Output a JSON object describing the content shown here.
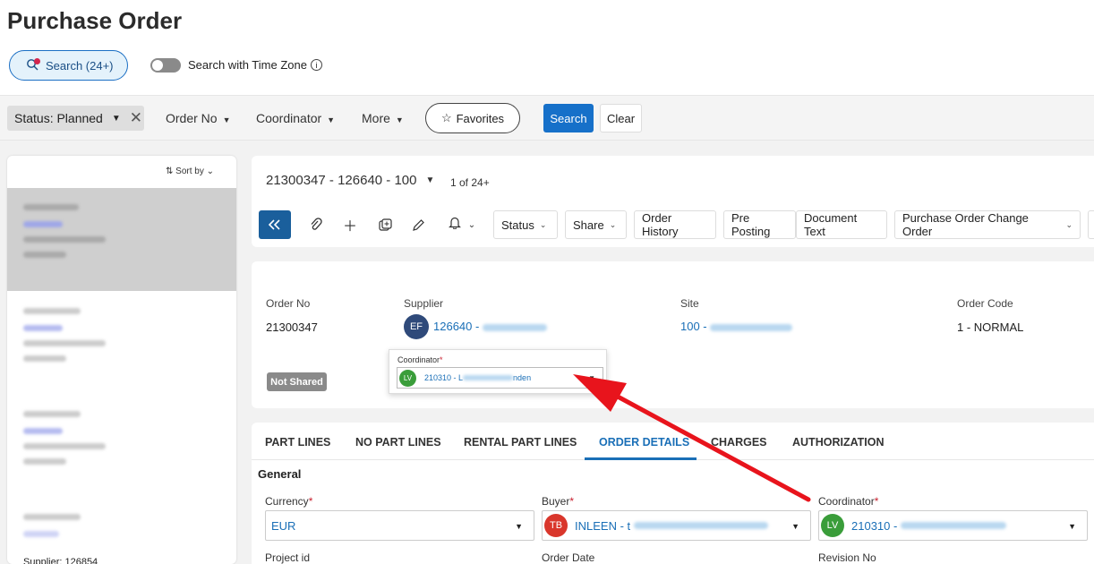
{
  "page": {
    "title": "Purchase Order"
  },
  "top": {
    "search_label": "Search (24+)",
    "timezone_label": "Search with Time Zone"
  },
  "filters": {
    "status_chip": "Status: Planned",
    "dropdowns": [
      "Order No",
      "Coordinator",
      "More"
    ],
    "favorites": "Favorites",
    "search": "Search",
    "clear": "Clear"
  },
  "list": {
    "sort_by": "Sort by",
    "supplier_peek": "Supplier: 126854"
  },
  "record": {
    "header": "21300347 - 126640 - 100",
    "count": "1 of 24+"
  },
  "toolbar": {
    "status": "Status",
    "share": "Share",
    "order_history": "Order History",
    "pre_posting": "Pre Posting",
    "document_text": "Document Text",
    "change_order": "Purchase Order Change Order"
  },
  "header_fields": {
    "order_no_label": "Order No",
    "order_no_value": "21300347",
    "supplier_label": "Supplier",
    "supplier_initials": "EF",
    "supplier_value": "126640 -",
    "site_label": "Site",
    "site_value": "100 -",
    "order_code_label": "Order Code",
    "order_code_value": "1 - NORMAL",
    "not_shared": "Not Shared"
  },
  "popup": {
    "label": "Coordinator",
    "initials": "LV",
    "value_prefix": "210310 - L",
    "value_suffix": "nden"
  },
  "tabs": [
    "PART LINES",
    "NO PART LINES",
    "RENTAL PART LINES",
    "ORDER DETAILS",
    "CHARGES",
    "AUTHORIZATION"
  ],
  "details": {
    "section": "General",
    "currency_label": "Currency",
    "currency_value": "EUR",
    "buyer_label": "Buyer",
    "buyer_initials": "TB",
    "buyer_value": "INLEEN - t",
    "coordinator_label": "Coordinator",
    "coordinator_initials": "LV",
    "coordinator_value": "210310 -",
    "project_label": "Project id",
    "order_date_label": "Order Date",
    "revision_label": "Revision No"
  },
  "colors": {
    "accent": "#1670c9",
    "annotation_arrow": "#e8141c",
    "avatar_lv": "#3a9d3a",
    "avatar_tb": "#d9362b",
    "avatar_ef": "#2f4a7a"
  }
}
